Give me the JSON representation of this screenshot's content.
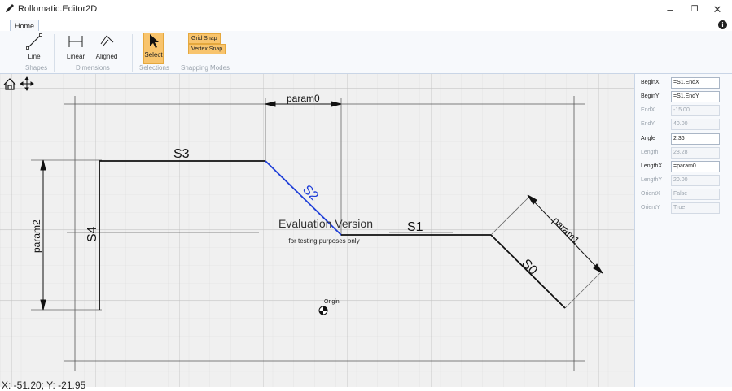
{
  "window": {
    "title": "Rollomatic.Editor2D",
    "minimize_glyph": "–",
    "maximize_glyph": "❐",
    "close_glyph": "✕"
  },
  "tabs": [
    {
      "label": "Home"
    }
  ],
  "info_glyph": "i",
  "ribbon": {
    "groups": {
      "shapes": "Shapes",
      "dimensions": "Dimensions",
      "selections": "Selections",
      "snapping": "Snapping Modes"
    },
    "buttons": {
      "line": "Line",
      "linear": "Linear",
      "aligned": "Aligned",
      "select": "Select",
      "grid_snap": "Grid Snap",
      "vertex_snap": "Vertex Snap"
    }
  },
  "canvas": {
    "labels": {
      "s0": "S0",
      "s1": "S1",
      "s2": "S2",
      "s3": "S3",
      "s4": "S4",
      "param0": "param0",
      "param1": "param1",
      "param2": "param2",
      "origin": "Origin"
    },
    "watermark": {
      "title": "Evaluation Version",
      "subtitle": "for testing purposes only"
    },
    "coords": "X: -51.20; Y: -21.95",
    "colors": {
      "selected_segment": "#1e3ed8",
      "geometry": "#111111",
      "grid": "#d8d8d8"
    }
  },
  "properties": [
    {
      "label": "BeginX",
      "value": "=S1.EndX",
      "enabled": true
    },
    {
      "label": "BeginY",
      "value": "=S1.EndY",
      "enabled": true
    },
    {
      "label": "EndX",
      "value": "-15.00",
      "enabled": false
    },
    {
      "label": "EndY",
      "value": "40.00",
      "enabled": false
    },
    {
      "label": "Angle",
      "value": "2.36",
      "enabled": true
    },
    {
      "label": "Length",
      "value": "28.28",
      "enabled": false
    },
    {
      "label": "LengthX",
      "value": "=param0",
      "enabled": true
    },
    {
      "label": "LengthY",
      "value": "20.00",
      "enabled": false
    },
    {
      "label": "OrientX",
      "value": "False",
      "enabled": false
    },
    {
      "label": "OrientY",
      "value": "True",
      "enabled": false
    }
  ]
}
